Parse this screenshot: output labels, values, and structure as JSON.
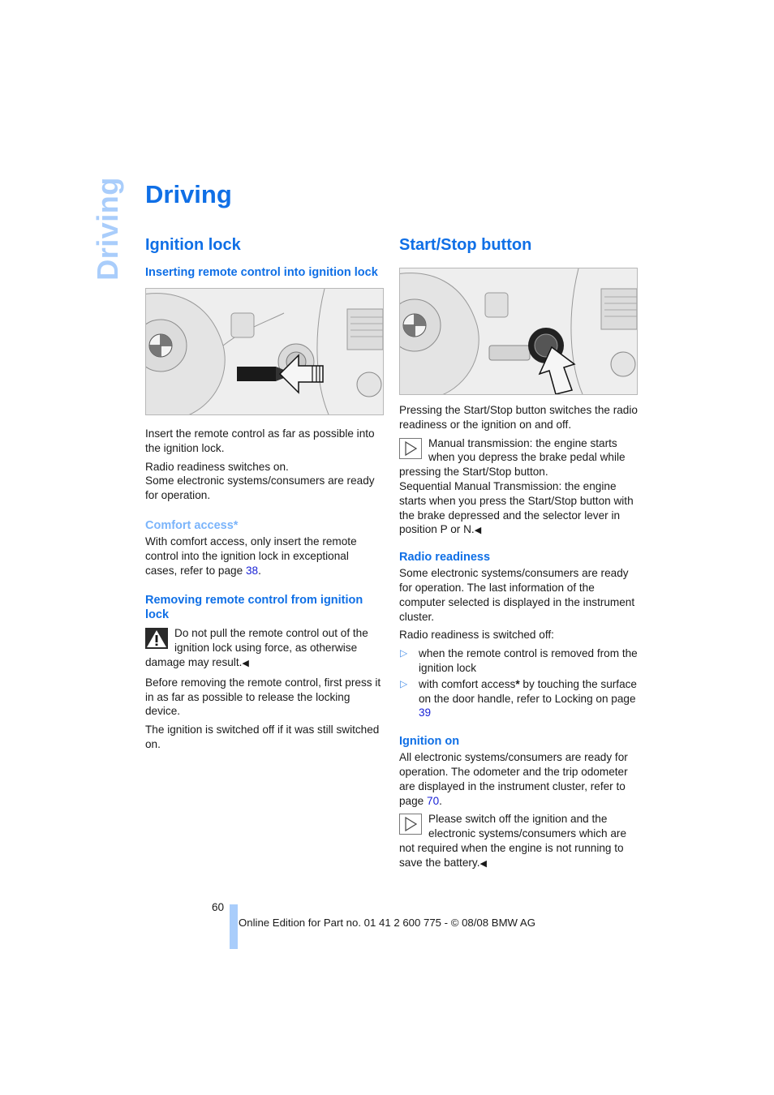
{
  "side_tab": "Driving",
  "title": "Driving",
  "left": {
    "heading": "Ignition lock",
    "sub1": "Inserting remote control into ignition lock",
    "figure1": "ignition-lock-illustration",
    "p1": "Insert the remote control as far as possible into the ignition lock.",
    "p2a": "Radio readiness switches on.",
    "p2b": "Some electronic systems/consumers are ready for operation.",
    "sub2": "Comfort access*",
    "p3_text": "With comfort access, only insert the remote control into the ignition lock in exceptional cases, refer to page ",
    "p3_link": "38",
    "p3_end": ".",
    "sub3": "Removing remote control from ignition lock",
    "warning_text": "Do not pull the remote control out of the ignition lock using force, as otherwise damage may result.",
    "end_mark": "◀",
    "p4": "Before removing the remote control, first press it in as far as possible to release the locking device.",
    "p5": "The ignition is switched off if it was still switched on."
  },
  "right": {
    "heading": "Start/Stop button",
    "figure2": "start-stop-button-illustration",
    "p1": "Pressing the Start/Stop button switches the radio readiness or the ignition on and off.",
    "note1a": "Manual transmission: the engine starts when you depress the brake pedal while pressing the Start/Stop button.",
    "note1b": "Sequential Manual Transmission: the engine starts when you press the Start/Stop button with the brake depressed and the selector lever in position P or N.",
    "sub1": "Radio readiness",
    "p2": "Some electronic systems/consumers are ready for operation. The last information of the computer selected is displayed in the instrument cluster.",
    "p3": "Radio readiness is switched off:",
    "bullet_glyph": "▷",
    "bullet1": "when the remote control is removed from the ignition lock",
    "bullet2_a": "with comfort access",
    "bullet2_star": "*",
    "bullet2_b": " by touching the surface on the door handle, refer to Locking on page ",
    "bullet2_link": "39",
    "sub2": "Ignition on",
    "p4_text": "All electronic systems/consumers are ready for operation. The odometer and the trip odometer are displayed in the instrument cluster, refer to page ",
    "p4_link": "70",
    "p4_end": ".",
    "note2": "Please switch off the ignition and the electronic systems/consumers which are not required when the engine is not running to save the battery.",
    "end_mark": "◀"
  },
  "footer": {
    "page_number": "60",
    "text": "Online Edition for Part no. 01 41 2 600 775 - © 08/08 BMW AG"
  },
  "colors": {
    "heading_blue": "#0f6fe6",
    "light_blue": "#a9cdfb",
    "link_blue": "#1a23d6"
  }
}
